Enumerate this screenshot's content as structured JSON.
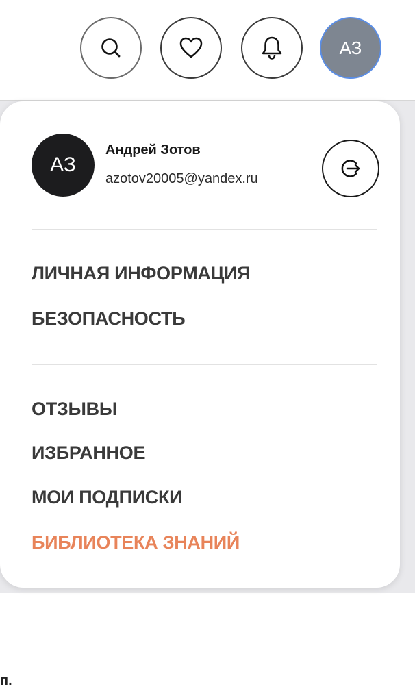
{
  "header": {
    "avatar_initials": "АЗ"
  },
  "profile": {
    "initials": "АЗ",
    "name": "Андрей Зотов",
    "email": "azotov20005@yandex.ru"
  },
  "menu": {
    "section1": [
      {
        "label": "ЛИЧНАЯ ИНФОРМАЦИЯ"
      },
      {
        "label": "БЕЗОПАСНОСТЬ"
      }
    ],
    "section2": [
      {
        "label": "ОТЗЫВЫ"
      },
      {
        "label": "ИЗБРАННОЕ"
      },
      {
        "label": "МОИ ПОДПИСКИ"
      },
      {
        "label": "БИБЛИОТЕКА ЗНАНИЙ"
      }
    ]
  },
  "background_fragment": "п.",
  "colors": {
    "accent": "#e8845a",
    "avatar_bg": "#7e8691",
    "avatar_border": "#5b8ee6",
    "menu_text": "#3a3a3a"
  },
  "icons": [
    "search-icon",
    "heart-icon",
    "bell-icon",
    "logout-icon"
  ]
}
